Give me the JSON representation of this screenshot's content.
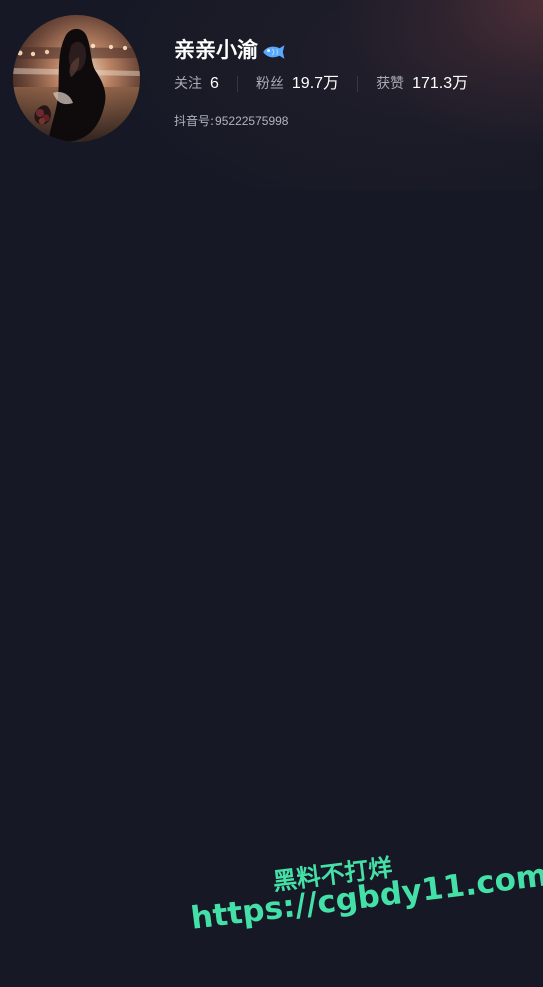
{
  "profile": {
    "nickname": "亲亲小渝",
    "badge_icon": "fish-icon",
    "stats": {
      "following_label": "关注",
      "following_value": "6",
      "followers_label": "粉丝",
      "followers_value": "19.7万",
      "likes_label": "获赞",
      "likes_value": "171.3万"
    },
    "account": {
      "label": "抖音号:",
      "value": "95222575998"
    }
  },
  "watermark": {
    "line1": "黑料不打烊",
    "line2": "https://cgbdy11.com",
    "color": "#45e0a8"
  },
  "colors": {
    "background": "#161925",
    "secondary_text": "#a8abb4",
    "fish_icon": "#59a8ff"
  }
}
